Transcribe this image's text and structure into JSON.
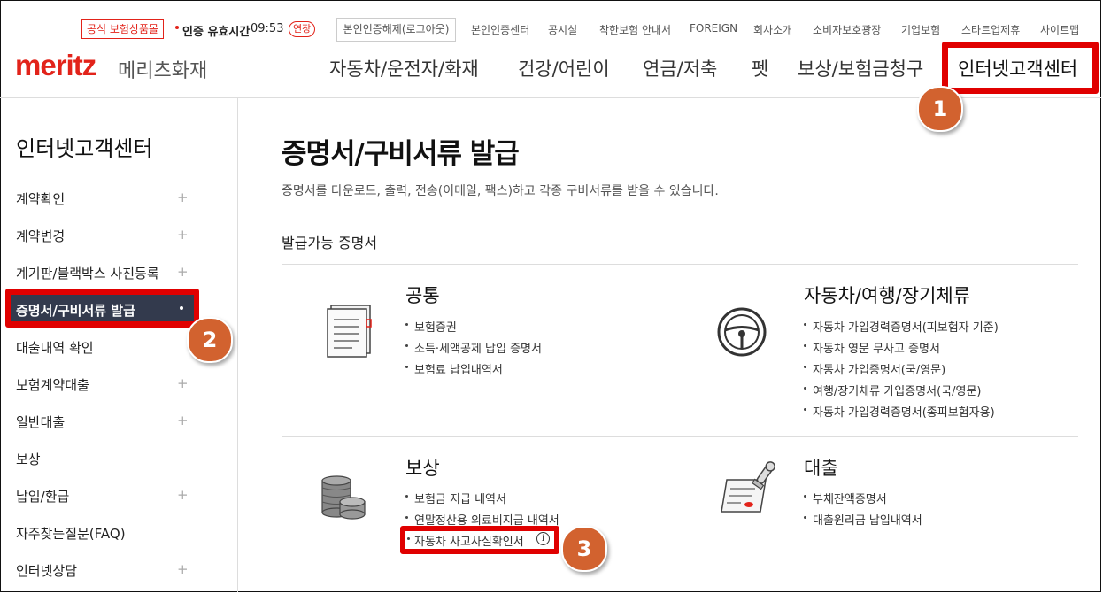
{
  "top_bar": {
    "official_badge": "공식 보험상품몰",
    "auth_label": "인증 유효시간",
    "auth_time": "09:53",
    "extend_label": "연장",
    "logout_label": "본인인증해제(로그아웃)",
    "links": [
      "본인인증센터",
      "공시실",
      "착한보험 안내서",
      "FOREIGN",
      "회사소개",
      "소비자보호광장",
      "기업보험",
      "스타트업제휴",
      "사이트맵"
    ]
  },
  "logo": {
    "main": "meritz",
    "sub": "메리츠화재"
  },
  "gnb": {
    "items": [
      "자동차/운전자/화재",
      "건강/어린이",
      "연금/저축",
      "펫",
      "보상/보험금청구"
    ],
    "active": "인터넷고객센터"
  },
  "steps": [
    "1",
    "2",
    "3"
  ],
  "sidebar": {
    "title": "인터넷고객센터",
    "items": [
      {
        "label": "계약확인",
        "plus": "+"
      },
      {
        "label": "계약변경",
        "plus": "+"
      },
      {
        "label": "계기판/블랙박스 사진등록",
        "plus": "+"
      },
      {
        "label": "증명서/구비서류 발급",
        "plus": ""
      },
      {
        "label": "대출내역 확인",
        "plus": ""
      },
      {
        "label": "보험계약대출",
        "plus": "+"
      },
      {
        "label": "일반대출",
        "plus": "+"
      },
      {
        "label": "보상",
        "plus": ""
      },
      {
        "label": "납입/환급",
        "plus": "+"
      },
      {
        "label": "자주찾는질문(FAQ)",
        "plus": ""
      },
      {
        "label": "인터넷상담",
        "plus": "+"
      }
    ]
  },
  "main": {
    "title": "증명서/구비서류 발급",
    "description": "증명서를 다운로드, 출력, 전송(이메일, 팩스)하고 각종 구비서류를 받을 수 있습니다.",
    "section_title": "발급가능 증명서",
    "cards": [
      {
        "title": "공통",
        "icon": "document-icon",
        "items": [
          "보험증권",
          "소득·세액공제 납입 증명서",
          "보험료 납입내역서"
        ]
      },
      {
        "title": "자동차/여행/장기체류",
        "icon": "steering-wheel-icon",
        "items": [
          "자동차 가입경력증명서(피보험자 기준)",
          "자동차 영문 무사고 증명서",
          "자동차 가입증명서(국/영문)",
          "여행/장기체류 가입증명서(국/영문)",
          "자동차 가입경력증명서(종피보험자용)"
        ]
      },
      {
        "title": "보상",
        "icon": "coins-icon",
        "items": [
          "보험금 지급 내역서",
          "연말정산용 의료비지급 내역서",
          "자동차 사고사실확인서"
        ]
      },
      {
        "title": "대출",
        "icon": "contract-stamp-icon",
        "items": [
          "부채잔액증명서",
          "대출원리금 납입내역서"
        ]
      }
    ]
  },
  "colors": {
    "brand": "#e2231a",
    "highlight": "#e00000",
    "marker": "#d2622f",
    "sidebar_active": "#333a4d"
  }
}
